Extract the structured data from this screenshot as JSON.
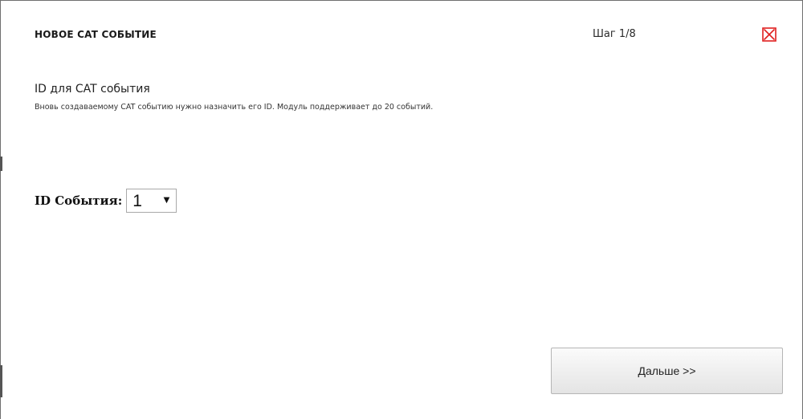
{
  "dialog": {
    "title": "НОВОЕ CAT СОБЫТИЕ",
    "step": "Шаг 1/8",
    "close_icon": "close-icon",
    "close_icon_color": "#e02020"
  },
  "section": {
    "title": "ID для CAT события",
    "description": "Вновь создаваемому CAT событию нужно назначить его ID. Модуль поддерживает до 20 событий."
  },
  "event_id": {
    "label": "ID События:",
    "selected_value": "1",
    "arrow": "▼"
  },
  "footer": {
    "next_label": "Дальше >>"
  }
}
